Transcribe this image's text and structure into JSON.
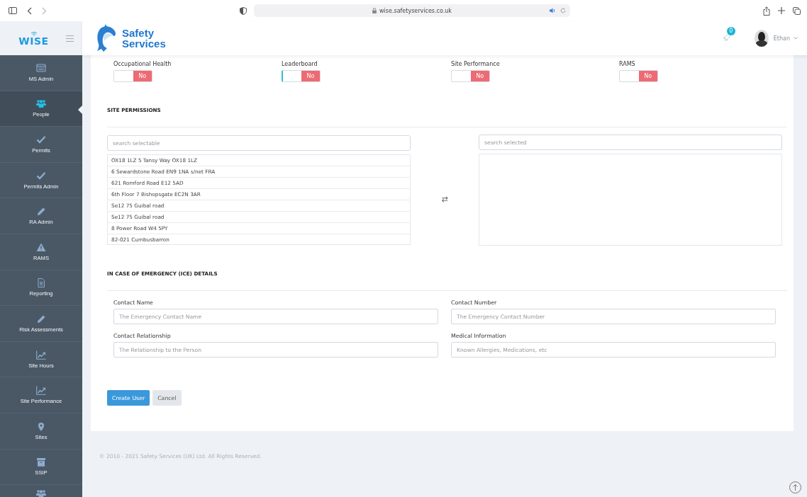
{
  "browser": {
    "url": "wise.safetyservices.co.uk"
  },
  "sidebar": {
    "logo": "WISE",
    "items": [
      {
        "label": "MS Admin",
        "selected": false
      },
      {
        "label": "People",
        "selected": true
      },
      {
        "label": "Permits",
        "selected": false
      },
      {
        "label": "Permits Admin",
        "selected": false
      },
      {
        "label": "RA Admin",
        "selected": false
      },
      {
        "label": "RAMS",
        "selected": false
      },
      {
        "label": "Reporting",
        "selected": false
      },
      {
        "label": "Risk Assessments",
        "selected": false
      },
      {
        "label": "Site Hours",
        "selected": false
      },
      {
        "label": "Site Performance",
        "selected": false
      },
      {
        "label": "Sites",
        "selected": false
      },
      {
        "label": "SSIP",
        "selected": false
      }
    ]
  },
  "header": {
    "brand_lines": [
      "Safety",
      "Services"
    ],
    "notification_count": "0",
    "user": "Ethan"
  },
  "permissions": [
    {
      "label": "Occupational Health",
      "toggle_text": "No",
      "on": false,
      "focused": false
    },
    {
      "label": "Leaderboard",
      "toggle_text": "No",
      "on": false,
      "focused": true
    },
    {
      "label": "Site Performance",
      "toggle_text": "No",
      "on": false,
      "focused": false
    },
    {
      "label": "RAMS",
      "toggle_text": "No",
      "on": false,
      "focused": false
    }
  ],
  "site_permissions": {
    "title": "SITE PERMISSIONS",
    "selectable_placeholder": "search selectable",
    "selected_placeholder": "search selected",
    "swap": "⇄",
    "selectable": [
      "OX18 1LZ 5 Tansy Way OX18 1LZ",
      "6 Sewardstone Road EN9 1NA s/net FRA",
      "621 Romford Road E12 5AD",
      "6th Floor 7 Bishopsgate EC2N 3AR",
      "Se12 75 Guibal road",
      "Se12 75 Guibal road",
      "8 Power Road W4 5PY",
      "82-021 Cumbusbarron"
    ]
  },
  "ice": {
    "title": "IN CASE OF EMERGENCY (ICE) DETAILS",
    "fields": [
      {
        "label": "Contact Name",
        "placeholder": "The Emergency Contact Name"
      },
      {
        "label": "Contact Number",
        "placeholder": "The Emergency Contact Number"
      },
      {
        "label": "Contact Relationship",
        "placeholder": "The Relationship to the Person"
      },
      {
        "label": "Medical Information",
        "placeholder": "Known Allergies, Medications, etc"
      }
    ]
  },
  "buttons": [
    {
      "label": "Create User",
      "kind": "primary"
    },
    {
      "label": "Cancel",
      "kind": "secondary"
    }
  ],
  "footer": "© 2010 - 2021 Safety Services (UK) Ltd. All Rights Reserved."
}
